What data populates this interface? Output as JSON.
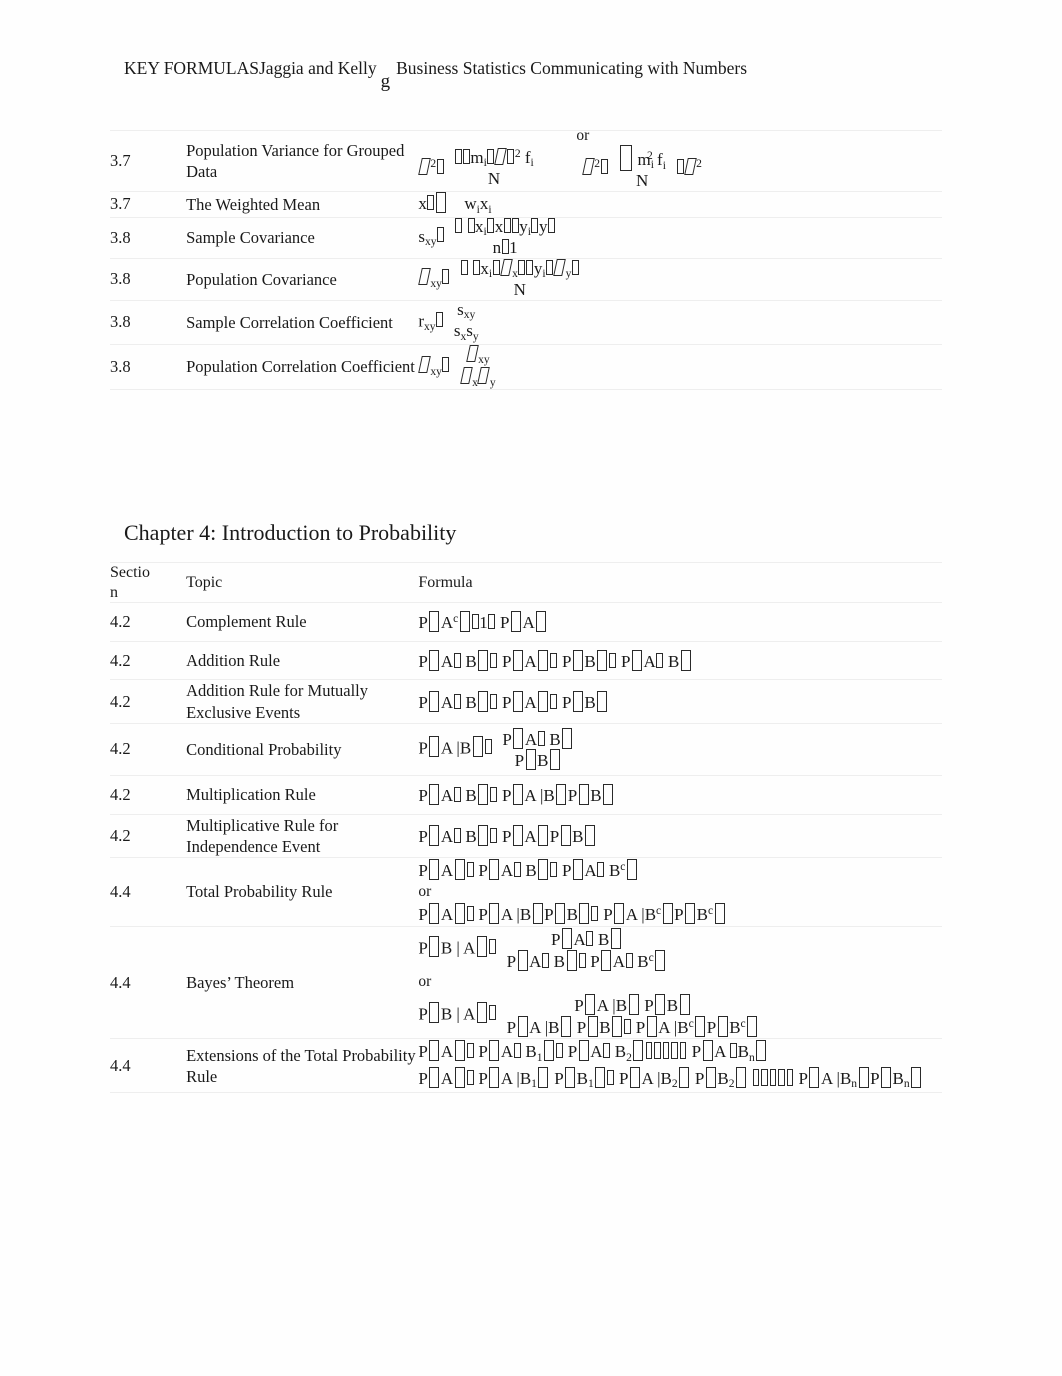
{
  "header": {
    "segment_1": "KEY FORMULASJaggia and Kelly",
    "dropped_letter": "g",
    "segment_2": "Business Statistics Communicating with Numbers"
  },
  "chapter3_table": {
    "rows": [
      {
        "section": "3.7",
        "topic": "Population Variance for Grouped Data",
        "formula_id": "pop-variance-grouped"
      },
      {
        "section": "3.7",
        "topic": "The Weighted Mean",
        "formula_id": "weighted-mean"
      },
      {
        "section": "3.8",
        "topic": "Sample Covariance",
        "formula_id": "sample-covariance"
      },
      {
        "section": "3.8",
        "topic": "Population Covariance",
        "formula_id": "population-covariance"
      },
      {
        "section": "3.8",
        "topic": "Sample Correlation Coefficient",
        "formula_id": "sample-correlation"
      },
      {
        "section": "3.8",
        "topic": "Population Correlation Coefficient",
        "formula_id": "population-correlation"
      }
    ]
  },
  "chapter4": {
    "title": "Chapter 4: Introduction to Probability",
    "columns": {
      "section": "Sectio\nn",
      "topic": "Topic",
      "formula": "Formula"
    },
    "rows": [
      {
        "section": "4.2",
        "topic": "Complement Rule",
        "formula_id": "complement-rule"
      },
      {
        "section": "4.2",
        "topic": "Addition Rule",
        "formula_id": "addition-rule"
      },
      {
        "section": "4.2",
        "topic": "Addition Rule for Mutually Exclusive Events",
        "formula_id": "addition-rule-mutually-exclusive"
      },
      {
        "section": "4.2",
        "topic": "Conditional Probability",
        "formula_id": "conditional-probability"
      },
      {
        "section": "4.2",
        "topic": "Multiplication Rule",
        "formula_id": "multiplication-rule"
      },
      {
        "section": "4.2",
        "topic": "Multiplicative Rule for Independence Event",
        "formula_id": "multiplicative-rule-independence"
      },
      {
        "section": "4.4",
        "topic": "Total Probability Rule",
        "formula_id": "total-probability-rule"
      },
      {
        "section": "4.4",
        "topic": "Bayes’ Theorem",
        "formula_id": "bayes-theorem"
      },
      {
        "section": "4.4",
        "topic": "Extensions of the Total Probability Rule",
        "formula_id": "extensions-total-probability"
      }
    ]
  },
  "math_text": {
    "or": "or",
    "N": "N",
    "n": "n",
    "one": "1",
    "two": "2",
    "P": "P",
    "A": "A",
    "B": "B",
    "c": "c",
    "x": "x",
    "y": "y",
    "s": "s",
    "r": "r",
    "m": "m",
    "f": "f",
    "w": "w",
    "i": "i",
    "xy": "xy",
    "bar_pipe": "|"
  }
}
